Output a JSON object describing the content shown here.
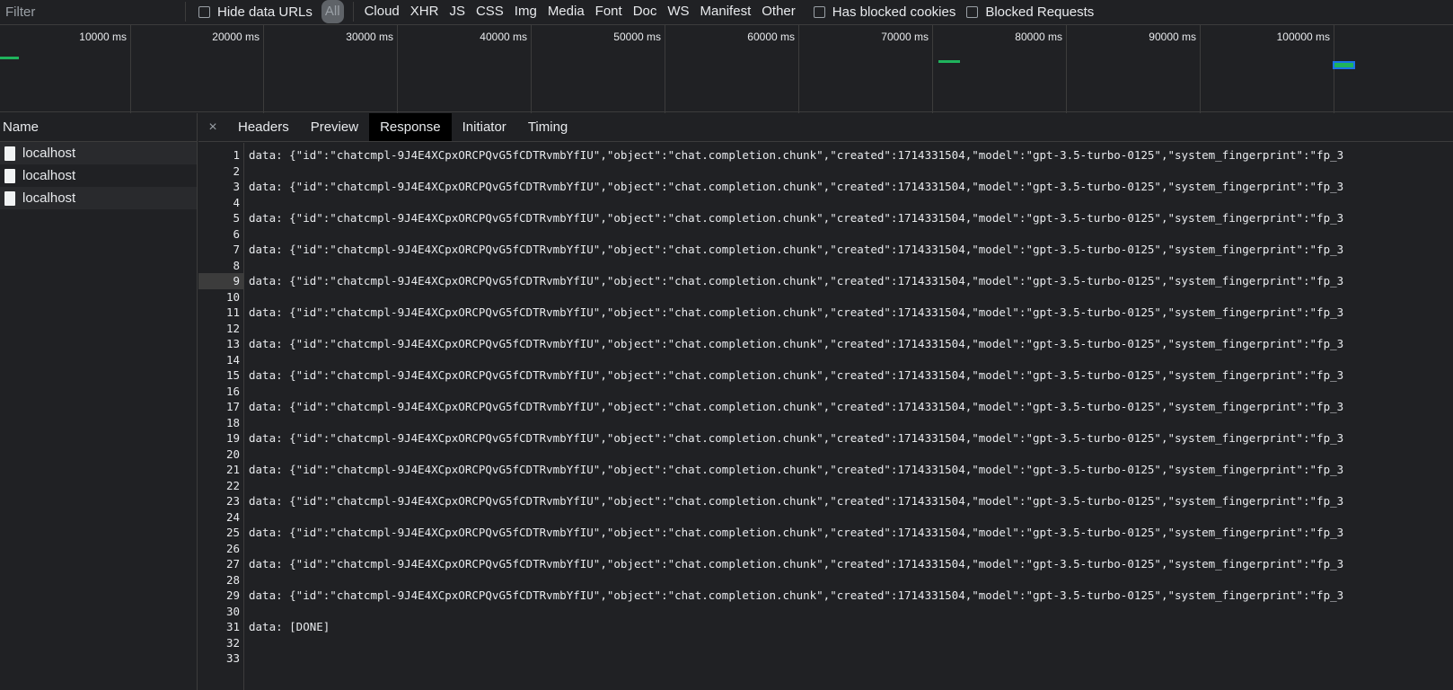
{
  "filter": {
    "placeholder": "Filter"
  },
  "toolbar": {
    "hide_data_urls": "Hide data URLs",
    "all": "All",
    "types": [
      "Cloud",
      "XHR",
      "JS",
      "CSS",
      "Img",
      "Media",
      "Font",
      "Doc",
      "WS",
      "Manifest",
      "Other"
    ],
    "has_blocked_cookies": "Has blocked cookies",
    "blocked_requests": "Blocked Requests"
  },
  "overview": {
    "ticks": [
      "10000 ms",
      "20000 ms",
      "30000 ms",
      "40000 ms",
      "50000 ms",
      "60000 ms",
      "70000 ms",
      "80000 ms",
      "90000 ms",
      "100000 ms"
    ]
  },
  "requests": {
    "header": "Name",
    "items": [
      {
        "name": "localhost"
      },
      {
        "name": "localhost"
      },
      {
        "name": "localhost"
      }
    ]
  },
  "detail": {
    "close_glyph": "×",
    "tabs": [
      "Headers",
      "Preview",
      "Response",
      "Initiator",
      "Timing"
    ],
    "active_tab": "Response"
  },
  "response": {
    "chunk_line": "data: {\"id\":\"chatcmpl-9J4E4XCpxORCPQvG5fCDTRvmbYfIU\",\"object\":\"chat.completion.chunk\",\"created\":1714331504,\"model\":\"gpt-3.5-turbo-0125\",\"system_fingerprint\":\"fp_3",
    "done_line": "data: [DONE]",
    "highlighted_line": 9,
    "line_count": 33
  },
  "colors": {
    "background": "#202124",
    "active_tab": "#000000",
    "bar": "#1fb35c",
    "selection": "#1a73e8"
  }
}
